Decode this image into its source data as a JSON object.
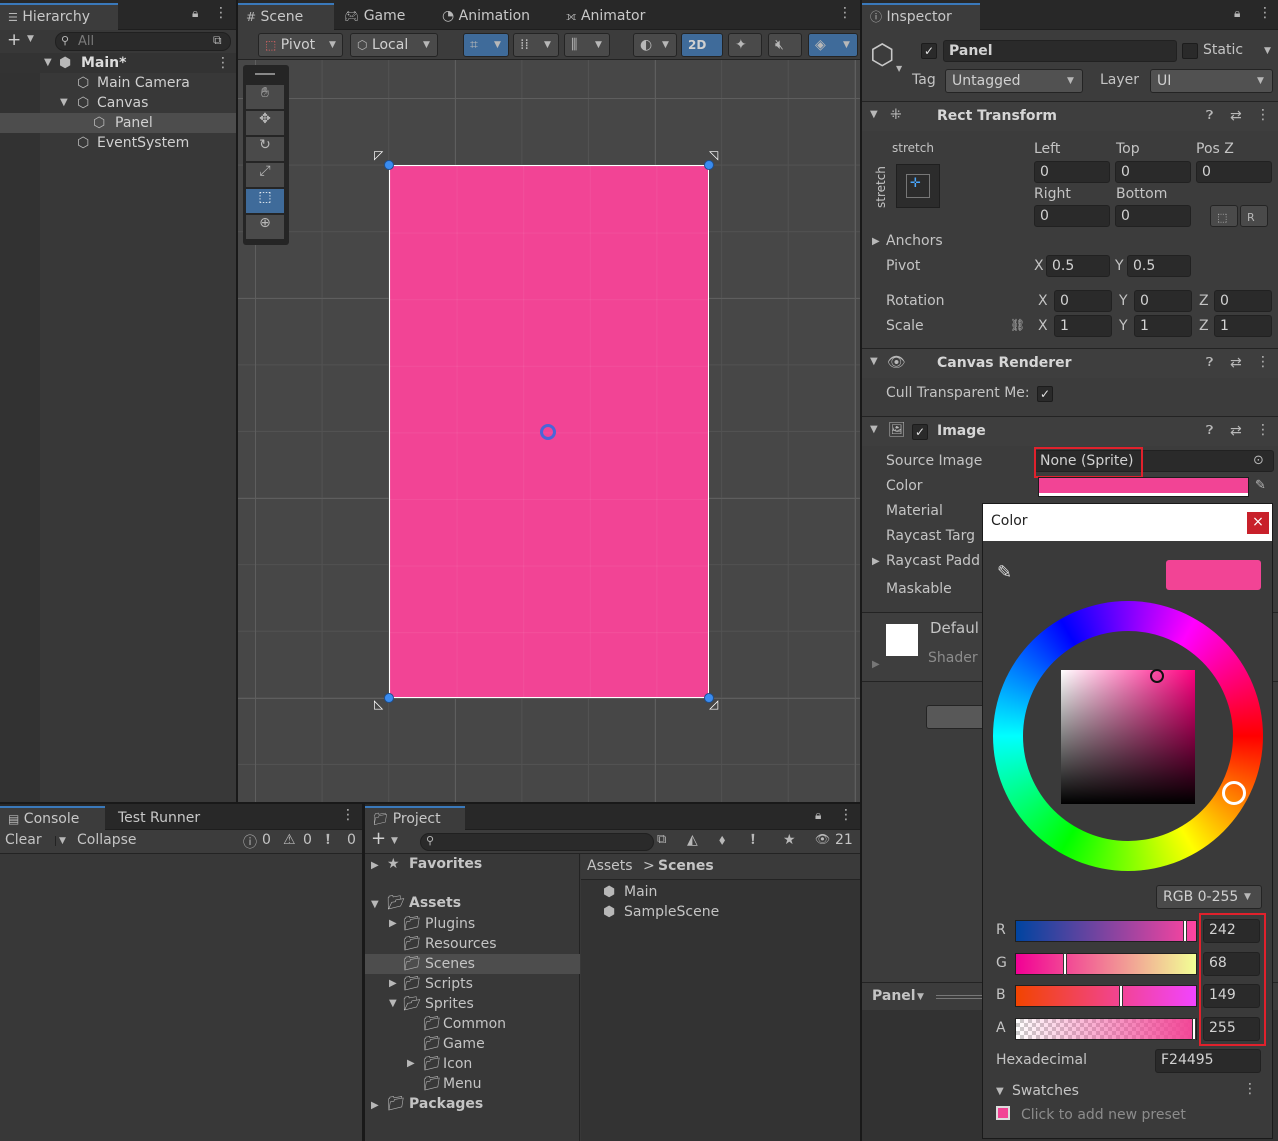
{
  "hierarchy": {
    "tab": "Hierarchy",
    "search_placeholder": "All",
    "root": "Main*",
    "items": [
      {
        "label": "Main Camera"
      },
      {
        "label": "Canvas"
      },
      {
        "label": "Panel"
      },
      {
        "label": "EventSystem"
      }
    ]
  },
  "scene": {
    "tabs": [
      "Scene",
      "Game",
      "Animation",
      "Animator"
    ],
    "pivot": "Pivot",
    "local": "Local",
    "mode_2d": "2D",
    "panel_color": "#f24495"
  },
  "inspector": {
    "tab": "Inspector",
    "object_name": "Panel",
    "static_label": "Static",
    "tag_label": "Tag",
    "tag_value": "Untagged",
    "layer_label": "Layer",
    "layer_value": "UI",
    "rect_transform": {
      "title": "Rect Transform",
      "anchor_preset_top": "stretch",
      "anchor_preset_side": "stretch",
      "left_label": "Left",
      "left": "0",
      "top_label": "Top",
      "top": "0",
      "posz_label": "Pos Z",
      "posz": "0",
      "right_label": "Right",
      "right": "0",
      "bottom_label": "Bottom",
      "bottom": "0",
      "anchors": "Anchors",
      "pivot_label": "Pivot",
      "pivot_x": "0.5",
      "pivot_y": "0.5",
      "rotation_label": "Rotation",
      "rot_x": "0",
      "rot_y": "0",
      "rot_z": "0",
      "scale_label": "Scale",
      "scale_x": "1",
      "scale_y": "1",
      "scale_z": "1",
      "x": "X",
      "y": "Y",
      "z": "Z"
    },
    "canvas_renderer": {
      "title": "Canvas Renderer",
      "cull_label": "Cull Transparent Me:"
    },
    "image": {
      "title": "Image",
      "source_label": "Source Image",
      "source_value": "None (Sprite)",
      "color_label": "Color",
      "material_label": "Material",
      "raycast_target_label": "Raycast Targ",
      "raycast_padding_label": "Raycast Padd",
      "maskable_label": "Maskable"
    },
    "material_preview": {
      "name": "Defaul",
      "shader": "Shader"
    },
    "preview_label": "Panel"
  },
  "color_picker": {
    "title": "Color",
    "close": "×",
    "mode": "RGB 0-255",
    "swatch_color": "#f24495",
    "channels": [
      {
        "label": "R",
        "value": "242",
        "fraction": 0.949
      },
      {
        "label": "G",
        "value": "68",
        "fraction": 0.267
      },
      {
        "label": "B",
        "value": "149",
        "fraction": 0.584
      },
      {
        "label": "A",
        "value": "255",
        "fraction": 1.0
      }
    ],
    "hex_label": "Hexadecimal",
    "hex_value": "F24495",
    "swatches_label": "Swatches",
    "preset_hint": "Click to add new preset"
  },
  "console": {
    "tabs": [
      "Console",
      "Test Runner"
    ],
    "clear": "Clear",
    "collapse": "Collapse",
    "counts": [
      "0",
      "0",
      "0"
    ]
  },
  "project": {
    "tab": "Project",
    "count": "21",
    "favorites": "Favorites",
    "assets": "Assets",
    "folders": [
      {
        "label": "Plugins"
      },
      {
        "label": "Resources"
      },
      {
        "label": "Scenes"
      },
      {
        "label": "Scripts"
      },
      {
        "label": "Sprites"
      },
      {
        "label": "Common"
      },
      {
        "label": "Game"
      },
      {
        "label": "Icon"
      },
      {
        "label": "Menu"
      }
    ],
    "packages": "Packages",
    "breadcrumb_root": "Assets",
    "breadcrumb_sep": ">",
    "breadcrumb_current": "Scenes",
    "files": [
      {
        "label": "Main"
      },
      {
        "label": "SampleScene"
      }
    ]
  }
}
